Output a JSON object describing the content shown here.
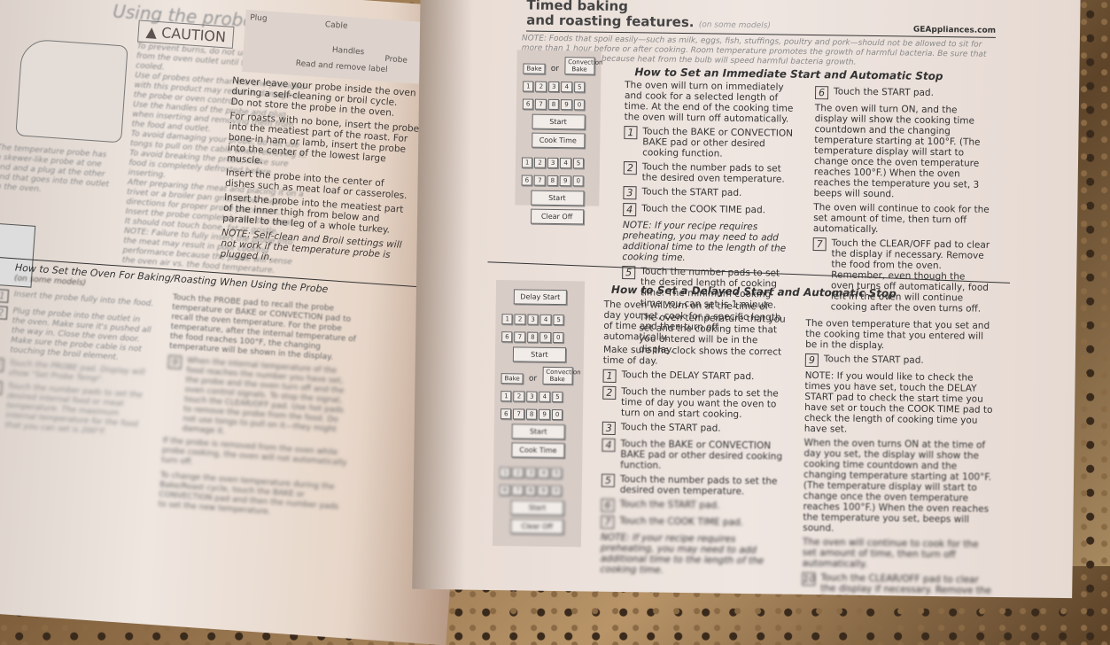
{
  "left_page": {
    "section_header": "Using the probe",
    "caution_title": "CAUTION",
    "caution_items": [
      "To prevent burns, do not unplug the probe from the oven outlet until the oven has cooled.",
      "Use of probes other than the one provided with this product may result in damage to the probe or oven control.",
      "Use the handles of the probe and plug when inserting and removing them from the food and outlet.",
      "To avoid damaging your probe, do not use tongs to pull on the cable when removing it.",
      "To avoid breaking the probe, make sure food is completely defrosted before inserting."
    ],
    "probe_caption": "The temperature probe has a skewer-like probe at one end and a plug at the other end that goes into the outlet in the oven.",
    "placement_text": "After preparing the meat and placing it on a trivet or a broiler pan grid, follow these directions for proper probe placement.",
    "insert_text": "Insert the probe completely into the meat. It should not touch bone, fat or gristle.",
    "note_left": "NOTE: Failure to fully insert the probe into the meat may result in poor cooking performance because the probe will sense the oven air vs. the food temperature.",
    "diagram_labels": [
      "Plug",
      "Cable",
      "Handles",
      "Probe",
      "Read and remove label"
    ],
    "bullets": [
      "Never leave your probe inside the oven during a self-cleaning or broil cycle.",
      "Do not store the probe in the oven."
    ],
    "paragraphs": [
      "For roasts with no bone, insert the probe into the meatiest part of the roast. For bone-in ham or lamb, insert the probe into the center of the lowest large muscle.",
      "Insert the probe into the center of dishes such as meat loaf or casseroles.",
      "Insert the probe into the meatiest part of the inner thigh from below and parallel to the leg of a whole turkey."
    ],
    "note_right": "NOTE: Self-clean and Broil settings will not work if the temperature probe is plugged in.",
    "section_title": "How to Set the Oven For Baking/Roasting When Using the Probe",
    "section_subtitle": "(on some models)",
    "steps": [
      {
        "n": "1",
        "text": "Insert the probe fully into the food."
      },
      {
        "n": "2",
        "text": "Plug the probe into the outlet in the oven. Make sure it's pushed all the way in. Close the oven door. Make sure the probe cable is not touching the broil element."
      },
      {
        "n": "3",
        "text": "Touch the PROBE pad. Display will show \"Set Probe Temp\"."
      },
      {
        "n": "4",
        "text": "Touch the number pads to set the desired internal food or meat temperature. The maximum internal temperature for the food that you can set is 200°F."
      }
    ],
    "right_col": "Touch the PROBE pad to recall the probe temperature or BAKE or CONVECTION pad to recall the oven temperature. For the probe temperature, after the internal temperature of the food reaches 100°F, the changing temperature will be shown in the display.",
    "step9": {
      "n": "9",
      "text": "When the internal temperature of the food reaches the number you have set, the probe and the oven turn off and the oven control signals. To stop the signal, touch the CLEAR/OFF pad. Use hot pads to remove the probe from the food. Do not use tongs to pull on it—they might damage it."
    },
    "bullet_removed": "If the probe is removed from the oven while probe cooking, the oven will not automatically turn off.",
    "change_temp": "To change the oven temperature during the Bake/Roast cycle, touch the BAKE or CONVECTION pad and then the number pads to set the new temperature."
  },
  "right_page": {
    "title_line1": "Timed baking",
    "title_line2": "and roasting features.",
    "title_sub": "(on some models)",
    "site": "GEAppliances.com",
    "note": "NOTE: Foods that spoil easily—such as milk, eggs, fish, stuffings, poultry and pork—should not be allowed to sit for more than 1 hour before or after cooking. Room temperature promotes the growth of harmful bacteria. Be sure that the oven light is off because heat from the bulb will speed harmful bacteria growth.",
    "keys": {
      "bake": "Bake",
      "or": "or",
      "conv_bake": "Convection Bake",
      "digits": [
        "1",
        "2",
        "3",
        "4",
        "5",
        "6",
        "7",
        "8",
        "9",
        "0"
      ],
      "start": "Start",
      "cook_time": "Cook Time",
      "clear_off": "Clear Off",
      "delay_start": "Delay Start"
    },
    "immediate": {
      "title": "How to Set an Immediate Start and Automatic Stop",
      "intro": "The oven will turn on immediately and cook for a selected length of time. At the end of the cooking time the oven will turn off automatically.",
      "steps": [
        {
          "n": "1",
          "text": "Touch the BAKE or CONVECTION BAKE pad or other desired cooking function."
        },
        {
          "n": "2",
          "text": "Touch the number pads to set the desired oven temperature."
        },
        {
          "n": "3",
          "text": "Touch the START pad."
        },
        {
          "n": "4",
          "text": "Touch the COOK TIME pad."
        }
      ],
      "note": "NOTE: If your recipe requires preheating, you may need to add additional time to the length of the cooking time.",
      "step5": {
        "n": "5",
        "text": "Touch the number pads to set the desired length of cooking time. The minimum cooking time you can set is 1 minute."
      },
      "after5": "The oven temperature that you set and the cooking time that you entered will be in the display.",
      "step6": {
        "n": "6",
        "text": "Touch the START pad."
      },
      "on_text": "The oven will turn ON, and the display will show the cooking time countdown and the changing temperature starting at 100°F. (The temperature display will start to change once the oven temperature reaches 100°F.) When the oven reaches the temperature you set, 3 beeps will sound.",
      "continue_text": "The oven will continue to cook for the set amount of time, then turn off automatically.",
      "step7": {
        "n": "7",
        "text": "Touch the CLEAR/OFF pad to clear the display if necessary. Remove the food from the oven. Remember, even though the oven turns off automatically, food left in the oven will continue cooking after the oven turns off."
      }
    },
    "delayed": {
      "title": "How to Set a Delayed Start and Automatic Stop",
      "intro": "The oven will turn on at the time of day you set, cook for a specific length of time and then turn off automatically.",
      "clock": "Make sure the clock shows the correct time of day.",
      "steps": [
        {
          "n": "1",
          "text": "Touch the DELAY START pad."
        },
        {
          "n": "2",
          "text": "Touch the number pads to set the time of day you want the oven to turn on and start cooking."
        },
        {
          "n": "3",
          "text": "Touch the START pad."
        },
        {
          "n": "4",
          "text": "Touch the BAKE or CONVECTION BAKE pad or other desired cooking function."
        },
        {
          "n": "5",
          "text": "Touch the number pads to set the desired oven temperature."
        },
        {
          "n": "6",
          "text": "Touch the START pad."
        },
        {
          "n": "7",
          "text": "Touch the COOK TIME pad."
        }
      ],
      "note": "NOTE: If your recipe requires preheating, you may need to add additional time to the length of the cooking time.",
      "right_intro": "The oven temperature that you set and the cooking time that you entered will be in the display.",
      "step9": {
        "n": "9",
        "text": "Touch the START pad."
      },
      "note2": "NOTE: If you would like to check the times you have set, touch the DELAY START pad to check the start time you have set or touch the COOK TIME pad to check the length of cooking time you have set.",
      "on_text": "When the oven turns ON at the time of day you set, the display will show the cooking time countdown and the changing temperature starting at 100°F. (The temperature display will start to change once the oven temperature reaches 100°F.) When the oven reaches the temperature you set, beeps will sound.",
      "continue_text": "The oven will continue to cook for the set amount of time, then turn off automatically.",
      "step10": {
        "n": "10",
        "text": "Touch the CLEAR/OFF pad to clear the display if necessary. Remove the food from the oven."
      }
    }
  }
}
